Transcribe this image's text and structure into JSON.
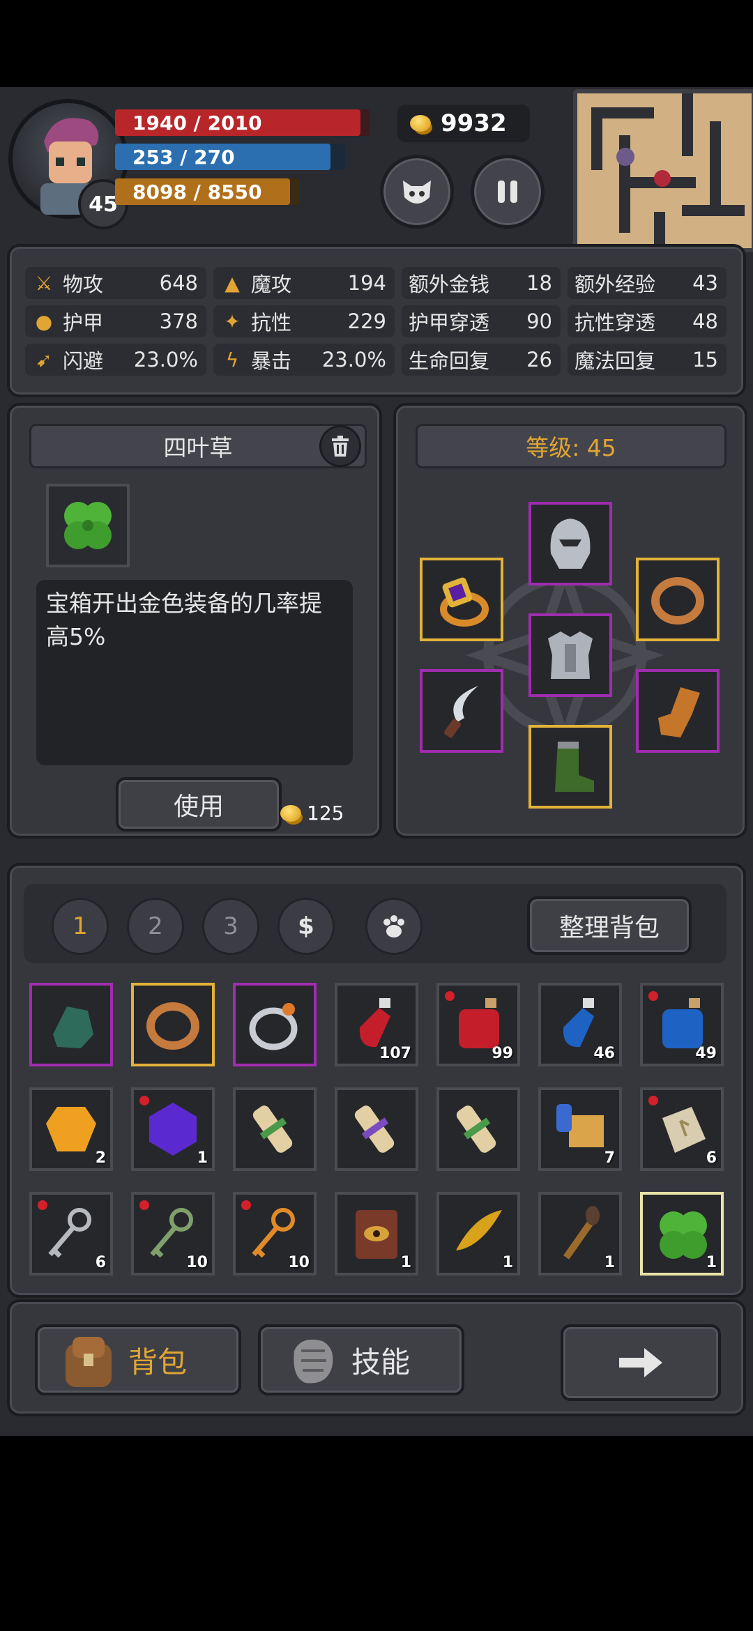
{
  "hud": {
    "level": "45",
    "hp": "1940 / 2010",
    "mp": "253 / 270",
    "xp": "8098 / 8550",
    "hp_fraction": 0.965,
    "mp_fraction": 0.937,
    "xp_fraction": 0.947,
    "gold": "9932"
  },
  "stats": [
    {
      "label": "物攻",
      "value": "648",
      "icon": "sword-icon"
    },
    {
      "label": "魔攻",
      "value": "194",
      "icon": "wizard-hat-icon"
    },
    {
      "label": "额外金钱",
      "value": "18",
      "icon": ""
    },
    {
      "label": "额外经验",
      "value": "43",
      "icon": ""
    },
    {
      "label": "护甲",
      "value": "378",
      "icon": "paw-shield-icon"
    },
    {
      "label": "抗性",
      "value": "229",
      "icon": "muscle-icon"
    },
    {
      "label": "护甲穿透",
      "value": "90",
      "icon": ""
    },
    {
      "label": "抗性穿透",
      "value": "48",
      "icon": ""
    },
    {
      "label": "闪避",
      "value": "23.0%",
      "icon": "running-icon"
    },
    {
      "label": "暴击",
      "value": "23.0%",
      "icon": "lightning-icon"
    },
    {
      "label": "生命回复",
      "value": "26",
      "icon": ""
    },
    {
      "label": "魔法回复",
      "value": "15",
      "icon": ""
    }
  ],
  "item_detail": {
    "name": "四叶草",
    "description": "宝箱开出金色装备的几率提高5%",
    "use_label": "使用",
    "sell_price": "125"
  },
  "equipment": {
    "level_label": "等级: 45"
  },
  "inventory": {
    "tabs": [
      "1",
      "2",
      "3",
      "$"
    ],
    "sort_label": "整理背包",
    "rows": [
      [
        {
          "icon": "gauntlet-icon",
          "border": "purple",
          "qty": "",
          "dot": false
        },
        {
          "icon": "gold-ring-icon",
          "border": "gold",
          "qty": "",
          "dot": false
        },
        {
          "icon": "silver-ring-icon",
          "border": "purple",
          "qty": "",
          "dot": false
        },
        {
          "icon": "red-potion-icon",
          "border": "normal",
          "qty": "107",
          "dot": false
        },
        {
          "icon": "big-red-potion-icon",
          "border": "normal",
          "qty": "99",
          "dot": true
        },
        {
          "icon": "blue-potion-icon",
          "border": "normal",
          "qty": "46",
          "dot": false
        },
        {
          "icon": "big-blue-potion-icon",
          "border": "normal",
          "qty": "49",
          "dot": true
        }
      ],
      [
        {
          "icon": "orange-gem-icon",
          "border": "normal",
          "qty": "2",
          "dot": false
        },
        {
          "icon": "purple-gem-icon",
          "border": "normal",
          "qty": "1",
          "dot": true
        },
        {
          "icon": "scroll-green-icon",
          "border": "normal",
          "qty": "",
          "dot": false
        },
        {
          "icon": "scroll-purple-icon",
          "border": "normal",
          "qty": "",
          "dot": false
        },
        {
          "icon": "scroll-green-icon",
          "border": "normal",
          "qty": "",
          "dot": false
        },
        {
          "icon": "map-scroll-icon",
          "border": "normal",
          "qty": "7",
          "dot": false
        },
        {
          "icon": "rune-stone-icon",
          "border": "normal",
          "qty": "6",
          "dot": true
        }
      ],
      [
        {
          "icon": "silver-key-icon",
          "border": "normal",
          "qty": "6",
          "dot": true
        },
        {
          "icon": "green-key-icon",
          "border": "normal",
          "qty": "10",
          "dot": true
        },
        {
          "icon": "gold-key-icon",
          "border": "normal",
          "qty": "10",
          "dot": true
        },
        {
          "icon": "eye-book-icon",
          "border": "normal",
          "qty": "1",
          "dot": false
        },
        {
          "icon": "feather-icon",
          "border": "normal",
          "qty": "1",
          "dot": false
        },
        {
          "icon": "torch-icon",
          "border": "normal",
          "qty": "1",
          "dot": false
        },
        {
          "icon": "clover-icon",
          "border": "selected",
          "qty": "1",
          "dot": false
        }
      ]
    ]
  },
  "bottom_nav": {
    "bag_label": "背包",
    "skill_label": "技能",
    "next_icon": "arrow-right-icon"
  }
}
